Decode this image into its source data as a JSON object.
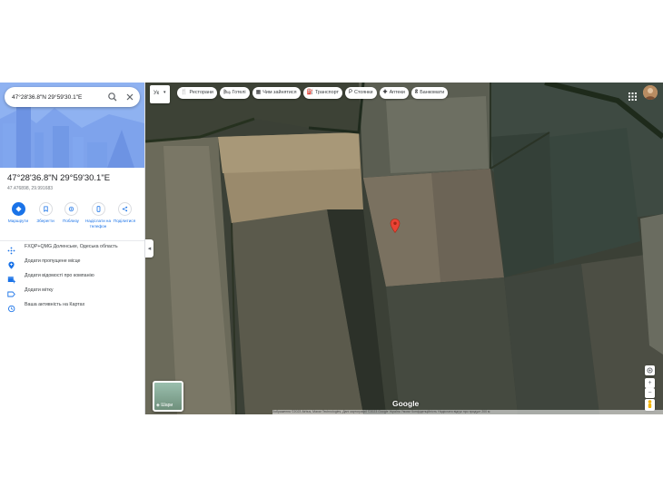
{
  "search": {
    "value": "47°28'36.8\"N 29°59'30.1\"E",
    "search_icon": "search-icon",
    "close_icon": "close-icon"
  },
  "place": {
    "title": "47°28'36.8\"N 29°59'30.1\"E",
    "decimal": "47.476898, 29.991683"
  },
  "actions": [
    {
      "label": "Маршрути",
      "icon": "directions-icon"
    },
    {
      "label": "Зберегти",
      "icon": "bookmark-icon"
    },
    {
      "label": "Поблизу",
      "icon": "nearby-icon"
    },
    {
      "label": "Надіслати на телефон",
      "icon": "phone-icon"
    },
    {
      "label": "Поділитися",
      "icon": "share-icon"
    }
  ],
  "details": [
    {
      "text": "FXQP+QMG Доленське, Одеська область",
      "icon": "plus-code-icon"
    },
    {
      "text": "Додати пропущене місце",
      "icon": "add-place-icon"
    },
    {
      "text": "Додати відомості про компанію",
      "icon": "business-icon"
    },
    {
      "text": "Додати мітку",
      "icon": "label-icon"
    },
    {
      "text": "Ваша активність на Картах",
      "icon": "history-icon"
    }
  ],
  "map": {
    "language": "Ук",
    "chips": [
      {
        "label": "Ресторани",
        "glyph": "🍴"
      },
      {
        "label": "Готелі",
        "glyph": "🛏"
      },
      {
        "label": "Чим зайнятися",
        "glyph": "▦"
      },
      {
        "label": "Транспорт",
        "glyph": "⛽"
      },
      {
        "label": "Стоянки",
        "glyph": "P"
      },
      {
        "label": "Аптеки",
        "glyph": "✚"
      },
      {
        "label": "Банкомати",
        "glyph": "₴"
      }
    ],
    "layers_label": "Шари",
    "logo": "Google",
    "attribution": "Зображення ©2023 Airbus, Maxar Technologies, Дані картографії ©2023 Google   Україна   Умови   Конфіденційність   Надіслати відгук про продукт   200 м",
    "zoom_in": "+",
    "zoom_out": "−",
    "colors": {
      "pin": "#ea4335",
      "accent": "#1a73e8"
    }
  }
}
